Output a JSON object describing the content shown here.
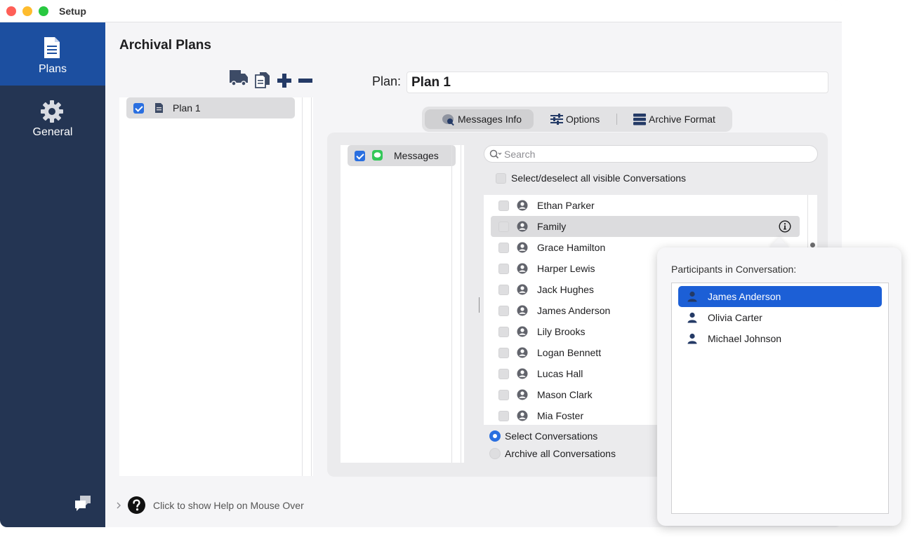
{
  "window": {
    "title": "Setup"
  },
  "sidebar": {
    "items": [
      {
        "label": "Plans",
        "icon": "document-icon",
        "active": true
      },
      {
        "label": "General",
        "icon": "gear-icon",
        "active": false
      }
    ]
  },
  "main": {
    "title": "Archival Plans",
    "plans": [
      {
        "label": "Plan 1",
        "checked": true
      }
    ],
    "plan_field": {
      "label": "Plan:",
      "value": "Plan 1"
    },
    "tabs": [
      {
        "label": "Messages Info",
        "active": true
      },
      {
        "label": "Options",
        "active": false
      },
      {
        "label": "Archive Format",
        "active": false
      }
    ]
  },
  "messages": {
    "services": [
      {
        "label": "Messages",
        "checked": true
      }
    ],
    "search": {
      "placeholder": "Search"
    },
    "select_all_label": "Select/deselect all visible Conversations",
    "conversations": [
      {
        "name": "Ethan Parker"
      },
      {
        "name": "Family",
        "selected": true
      },
      {
        "name": "Grace Hamilton"
      },
      {
        "name": "Harper Lewis"
      },
      {
        "name": "Jack Hughes"
      },
      {
        "name": "James Anderson"
      },
      {
        "name": "Lily Brooks"
      },
      {
        "name": "Logan Bennett"
      },
      {
        "name": "Lucas Hall"
      },
      {
        "name": "Mason Clark"
      },
      {
        "name": "Mia Foster"
      }
    ],
    "mode": {
      "select_label": "Select Conversations",
      "archive_all_label": "Archive all Conversations",
      "selected": "select"
    }
  },
  "popover": {
    "title": "Participants in Conversation:",
    "participants": [
      {
        "name": "James Anderson",
        "selected": true
      },
      {
        "name": "Olivia Carter"
      },
      {
        "name": "Michael Johnson"
      }
    ]
  },
  "help": {
    "label": "Click to show Help on Mouse Over"
  },
  "colors": {
    "sidebar": "#243553",
    "sidebar_active": "#1c4fa0",
    "accent": "#2a6fe0",
    "selection": "#1c5fd6"
  }
}
